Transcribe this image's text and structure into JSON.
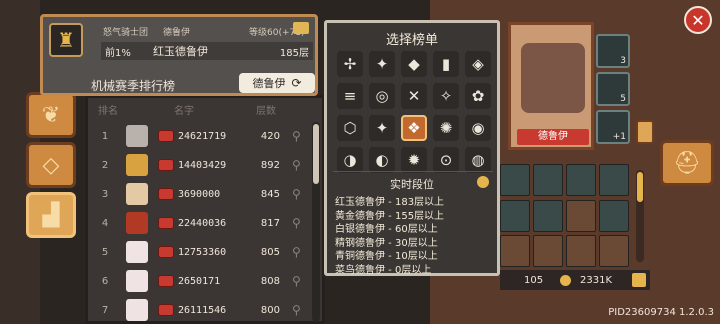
{
  "header": {
    "guild": "怒气骑士团",
    "char_class": "德鲁伊",
    "level": "等级60(+71)",
    "percentile": "前1%",
    "rank_title": "红玉德鲁伊",
    "floors": "185层",
    "board_title": "机械赛季排行榜",
    "class_select": "德鲁伊"
  },
  "columns": {
    "rank": "排名",
    "name": "名字",
    "floor": "层数"
  },
  "rows": [
    {
      "rank": "1",
      "pid": "24621719",
      "floor": "420"
    },
    {
      "rank": "2",
      "pid": "14403429",
      "floor": "892"
    },
    {
      "rank": "3",
      "pid": "3690000",
      "floor": "845"
    },
    {
      "rank": "4",
      "pid": "22440036",
      "floor": "817"
    },
    {
      "rank": "5",
      "pid": "12753360",
      "floor": "805"
    },
    {
      "rank": "6",
      "pid": "2650171",
      "floor": "808"
    },
    {
      "rank": "7",
      "pid": "26111546",
      "floor": "800"
    }
  ],
  "popup": {
    "title": "选择榜单",
    "realtime_title": "实时段位",
    "tiers": [
      "红玉德鲁伊 - 183层以上",
      "黄金德鲁伊 - 155层以上",
      "白银德鲁伊 - 60层以上",
      "精钢德鲁伊 - 30层以上",
      "青铜德鲁伊 - 10层以上",
      "菜鸟德鲁伊 - 0层以上"
    ],
    "icons": [
      "✢",
      "✦",
      "◆",
      "▮",
      "◈",
      "≡",
      "◎",
      "✕",
      "✧",
      "✿",
      "⬡",
      "✦",
      "❖",
      "✺",
      "◉",
      "◑",
      "◐",
      "✹",
      "⊙",
      "◍"
    ]
  },
  "character": {
    "label": "德鲁伊",
    "skills": [
      "3",
      "5",
      "+1"
    ]
  },
  "currency": {
    "gems": "105",
    "coins": "2331K"
  },
  "version": "PID23609734 1.2.0.3",
  "colors": {
    "accent": "#c08a53",
    "danger": "#c83a30",
    "selected": "#c2692f"
  }
}
